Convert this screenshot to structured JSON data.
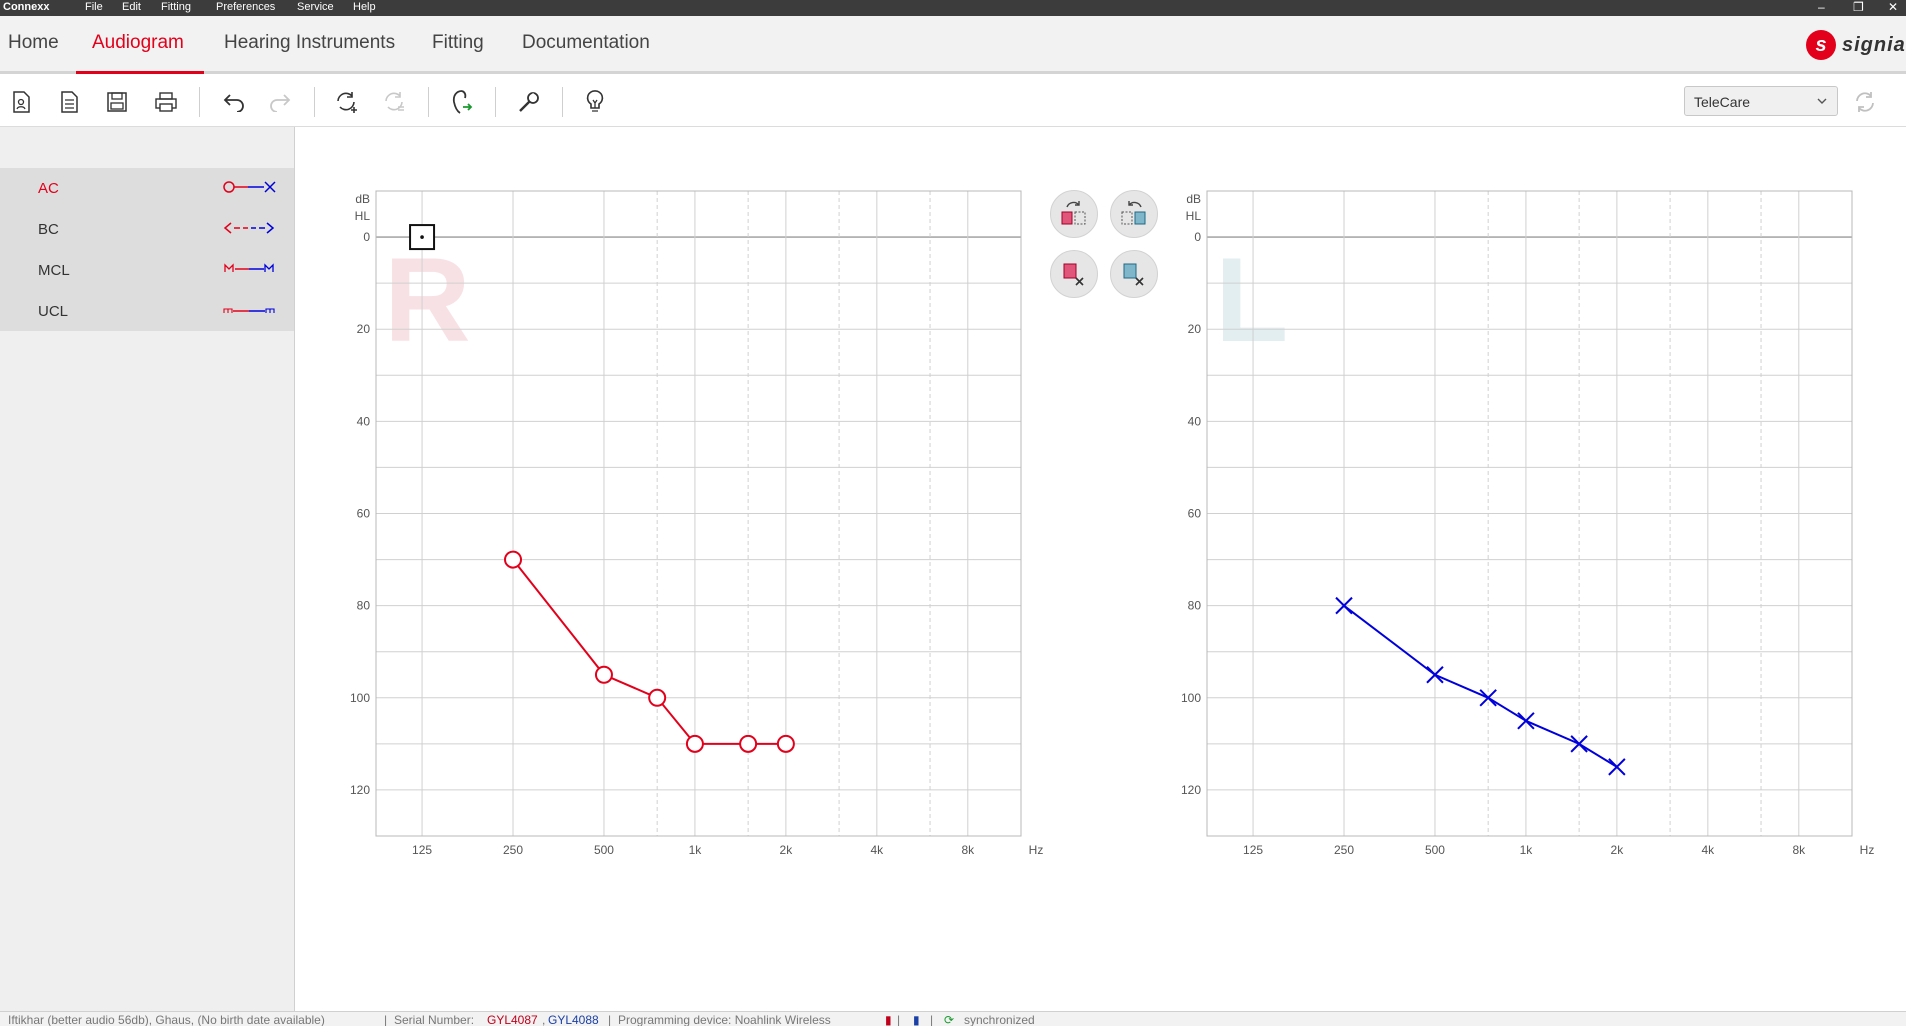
{
  "titlebar": {
    "app": "Connexx",
    "menus": [
      "File",
      "Edit",
      "Fitting",
      "Preferences",
      "Service",
      "Help"
    ]
  },
  "nav": {
    "tabs": [
      "Home",
      "Audiogram",
      "Hearing Instruments",
      "Fitting",
      "Documentation"
    ],
    "active_tab": "Audiogram",
    "brand": "signia"
  },
  "toolbar": {
    "icons": [
      "new-client-icon",
      "document-icon",
      "save-icon",
      "print-icon",
      "undo-icon",
      "redo-icon",
      "sync-add-icon",
      "sync-icon",
      "connect-hearing-aid-icon",
      "wrench-icon",
      "lightbulb-icon"
    ],
    "dropdown_value": "TeleCare",
    "refresh_icon": "refresh-icon"
  },
  "legend": {
    "items": [
      {
        "label": "AC",
        "active": true
      },
      {
        "label": "BC",
        "active": false
      },
      {
        "label": "MCL",
        "active": false
      },
      {
        "label": "UCL",
        "active": false
      }
    ]
  },
  "audiogram": {
    "y_unit_top": "dB",
    "y_unit_bottom": "HL",
    "x_unit": "Hz",
    "y_ticks": [
      "0",
      "20",
      "40",
      "60",
      "80",
      "100",
      "120"
    ],
    "x_ticks": [
      "125",
      "250",
      "500",
      "1k",
      "2k",
      "4k",
      "8k"
    ],
    "right_watermark": "R",
    "left_watermark": "L"
  },
  "chart_data": [
    {
      "type": "line",
      "title": "",
      "xlabel": "Hz",
      "ylabel": "dB HL",
      "x_scale": "log",
      "y_inverted": true,
      "ylim": [
        -10,
        130
      ],
      "x_ticks": [
        125,
        250,
        500,
        1000,
        2000,
        4000,
        8000
      ],
      "watermark": "R",
      "series": [
        {
          "color": "#e3001b",
          "marker": "circle",
          "points": [
            [
              250,
              70
            ],
            [
              500,
              95
            ],
            [
              750,
              100
            ],
            [
              1000,
              110
            ],
            [
              1500,
              110
            ],
            [
              2000,
              110
            ]
          ]
        }
      ]
    },
    {
      "type": "line",
      "title": "",
      "xlabel": "Hz",
      "ylabel": "dB HL",
      "x_scale": "log",
      "y_inverted": true,
      "ylim": [
        -10,
        130
      ],
      "x_ticks": [
        125,
        250,
        500,
        1000,
        2000,
        4000,
        8000
      ],
      "watermark": "L",
      "series": [
        {
          "color": "#0000dd",
          "marker": "x",
          "points": [
            [
              250,
              80
            ],
            [
              500,
              95
            ],
            [
              750,
              100
            ],
            [
              1000,
              105
            ],
            [
              1500,
              110
            ],
            [
              2000,
              115
            ]
          ]
        }
      ]
    }
  ],
  "statusbar": {
    "client": "Iftikhar (better audio 56db), Ghaus, (No birth date available)",
    "serial_label": "Serial Number:",
    "serial_right": "GYL4087",
    "serial_left": "GYL4088",
    "device": "Programming device: Noahlink Wireless",
    "sync_status": "synchronized"
  },
  "colors": {
    "accent": "#e3001b",
    "right_ear": "#e3001b",
    "left_ear": "#0000dd"
  }
}
